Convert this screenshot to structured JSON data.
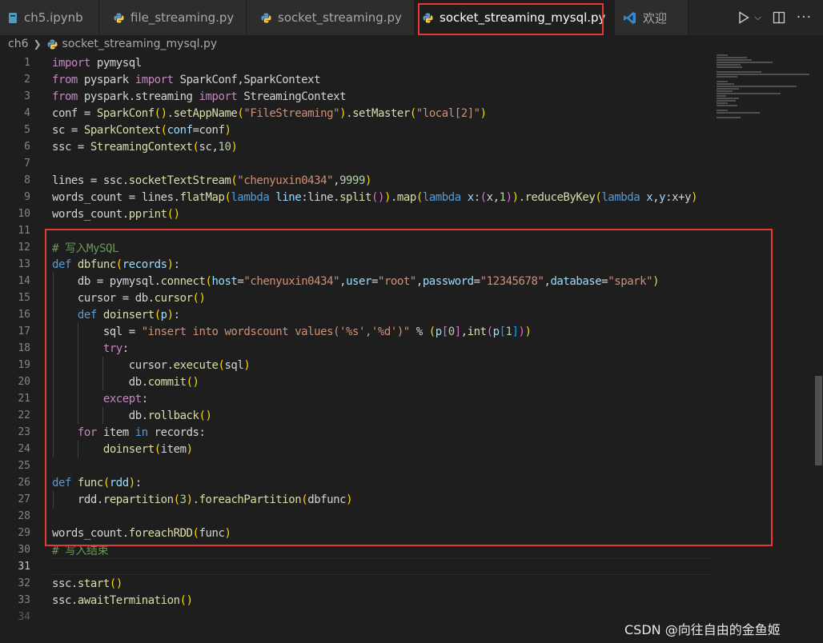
{
  "tabs": [
    {
      "label": "ch5.ipynb",
      "icon": "notebook-icon"
    },
    {
      "label": "file_streaming.py",
      "icon": "python-icon"
    },
    {
      "label": "socket_streaming.py",
      "icon": "python-icon"
    },
    {
      "label": "socket_streaming_mysql.py",
      "icon": "python-icon",
      "active": true
    },
    {
      "label": "欢迎",
      "icon": "vscode-icon"
    }
  ],
  "breadcrumb": {
    "folder": "ch6",
    "file": "socket_streaming_mysql.py"
  },
  "code_lines": [
    {
      "n": "1"
    },
    {
      "n": "2"
    },
    {
      "n": "3"
    },
    {
      "n": "4"
    },
    {
      "n": "5"
    },
    {
      "n": "6"
    },
    {
      "n": "7"
    },
    {
      "n": "8"
    },
    {
      "n": "9"
    },
    {
      "n": "10"
    },
    {
      "n": "11"
    },
    {
      "n": "12"
    },
    {
      "n": "13"
    },
    {
      "n": "14"
    },
    {
      "n": "15"
    },
    {
      "n": "16"
    },
    {
      "n": "17"
    },
    {
      "n": "18"
    },
    {
      "n": "19"
    },
    {
      "n": "20"
    },
    {
      "n": "21"
    },
    {
      "n": "22"
    },
    {
      "n": "23"
    },
    {
      "n": "24"
    },
    {
      "n": "25"
    },
    {
      "n": "26"
    },
    {
      "n": "27"
    },
    {
      "n": "28"
    },
    {
      "n": "29"
    },
    {
      "n": "30"
    },
    {
      "n": "31"
    },
    {
      "n": "32"
    },
    {
      "n": "33"
    },
    {
      "n": "34"
    }
  ],
  "tokens": {
    "l1": [
      "import",
      " pymysql"
    ],
    "l2": [
      "from",
      " pyspark ",
      "import",
      " SparkConf,SparkContext"
    ],
    "l3": [
      "from",
      " pyspark.streaming ",
      "import",
      " StreamingContext"
    ],
    "l4": [
      "conf = ",
      "SparkConf",
      "(",
      ")",
      ".",
      "setAppName",
      "(",
      "\"FileStreaming\"",
      ")",
      ".",
      "setMaster",
      "(",
      "\"local[2]\"",
      ")"
    ],
    "l5": [
      "sc = ",
      "SparkContext",
      "(",
      "conf",
      "=conf",
      ")"
    ],
    "l6": [
      "ssc = ",
      "StreamingContext",
      "(",
      "sc,",
      "10",
      ")"
    ],
    "l8": [
      "lines = ssc.",
      "socketTextStream",
      "(",
      "\"chenyuxin0434\"",
      ",",
      "9999",
      ")"
    ],
    "l9": [
      "words_count = lines.",
      "flatMap",
      "(",
      "lambda",
      " ",
      "line",
      ":line.",
      "split",
      "(",
      ")",
      ")",
      ".",
      "map",
      "(",
      "lambda",
      " ",
      "x",
      ":",
      "(",
      "x,",
      "1",
      ")",
      ")",
      ".",
      "reduceByKey",
      "(",
      "lambda",
      " ",
      "x",
      ",",
      "y",
      ":x+y",
      ")"
    ],
    "l10": [
      "words_count.",
      "pprint",
      "(",
      ")"
    ],
    "l12": [
      "# 写入MySQL"
    ],
    "l13": [
      "def",
      " ",
      "dbfunc",
      "(",
      "records",
      ")",
      ":"
    ],
    "l14": [
      "    db = pymysql.",
      "connect",
      "(",
      "host",
      "=",
      "\"chenyuxin0434\"",
      ",",
      "user",
      "=",
      "\"root\"",
      ",",
      "password",
      "=",
      "\"12345678\"",
      ",",
      "database",
      "=",
      "\"spark\"",
      ")"
    ],
    "l15": [
      "    cursor = db.",
      "cursor",
      "(",
      ")"
    ],
    "l16": [
      "    ",
      "def",
      " ",
      "doinsert",
      "(",
      "p",
      ")",
      ":"
    ],
    "l17": [
      "        sql = ",
      "\"insert into wordscount values('%s','%d')\"",
      " % ",
      "(",
      "p",
      "[",
      "0",
      "]",
      ",",
      "int",
      "(",
      "p",
      "[",
      "1",
      "]",
      ")",
      ")"
    ],
    "l18": [
      "        ",
      "try",
      ":"
    ],
    "l19": [
      "            cursor.",
      "execute",
      "(",
      "sql",
      ")"
    ],
    "l20": [
      "            db.",
      "commit",
      "(",
      ")"
    ],
    "l21": [
      "        ",
      "except",
      ":"
    ],
    "l22": [
      "            db.",
      "rollback",
      "(",
      ")"
    ],
    "l23": [
      "    ",
      "for",
      " item ",
      "in",
      " records:"
    ],
    "l24": [
      "        ",
      "doinsert",
      "(",
      "item",
      ")"
    ],
    "l26": [
      "def",
      " ",
      "func",
      "(",
      "rdd",
      ")",
      ":"
    ],
    "l27": [
      "    rdd.",
      "repartition",
      "(",
      "3",
      ")",
      ".",
      "foreachPartition",
      "(",
      "dbfunc",
      ")"
    ],
    "l29": [
      "words_count.",
      "foreachRDD",
      "(",
      "func",
      ")"
    ],
    "l30": [
      "# 写入结束"
    ],
    "l32": [
      "ssc.",
      "start",
      "(",
      ")"
    ],
    "l33": [
      "ssc.",
      "awaitTermination",
      "(",
      ")"
    ]
  },
  "watermark": "CSDN @向往自由的金鱼姬",
  "colors": {
    "editor_bg": "#1e1e1e",
    "tab_bg": "#2d2d2d",
    "keyword": "#c586c0",
    "def_keyword": "#569cd6",
    "function": "#dcdcaa",
    "string": "#ce9178",
    "number": "#b5cea8",
    "parameter": "#9cdcfe",
    "comment": "#6a9955",
    "highlight_box": "#e53935"
  }
}
